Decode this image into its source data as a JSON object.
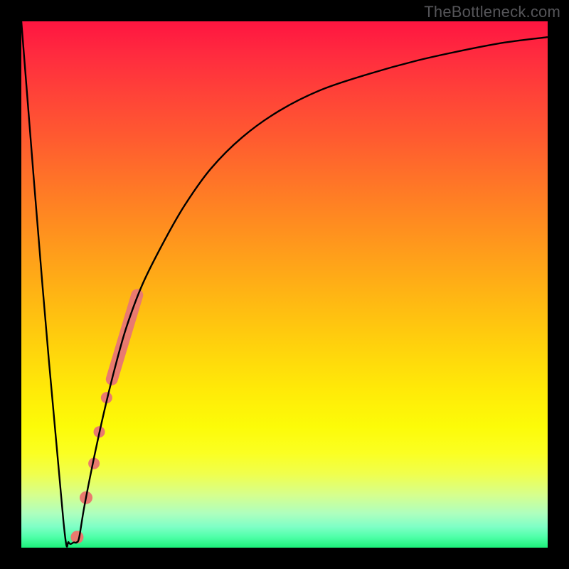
{
  "watermark": "TheBottleneck.com",
  "chart_data": {
    "type": "line",
    "title": "",
    "xlabel": "",
    "ylabel": "",
    "xlim": [
      0,
      100
    ],
    "ylim": [
      0,
      100
    ],
    "grid": false,
    "series": [
      {
        "name": "curve",
        "x": [
          0,
          4,
          8,
          9,
          10,
          10.5,
          11,
          12,
          14,
          16,
          18,
          20,
          23,
          27,
          31,
          36,
          42,
          49,
          57,
          66,
          75,
          84,
          92,
          100
        ],
        "y": [
          100,
          50,
          5,
          1,
          1,
          1,
          2,
          8,
          18,
          27,
          35,
          42,
          50,
          58,
          65,
          72,
          78,
          83,
          87,
          90,
          92.5,
          94.5,
          96,
          97
        ],
        "stroke": "#000000",
        "stroke_width": 2.4
      }
    ],
    "highlight": {
      "name": "highlight-segment",
      "color": "#e97a6f",
      "segments": [
        {
          "type": "bar",
          "x1": 17.2,
          "y1": 32,
          "x2": 22.0,
          "y2": 48,
          "width": 17
        },
        {
          "type": "dot",
          "x": 16.2,
          "y": 28.5,
          "r": 8
        },
        {
          "type": "dot",
          "x": 14.8,
          "y": 22.0,
          "r": 8
        },
        {
          "type": "dot",
          "x": 13.8,
          "y": 16.0,
          "r": 8
        },
        {
          "type": "dot",
          "x": 12.3,
          "y": 9.5,
          "r": 9
        },
        {
          "type": "dot",
          "x": 10.6,
          "y": 2.0,
          "r": 9
        }
      ]
    }
  }
}
